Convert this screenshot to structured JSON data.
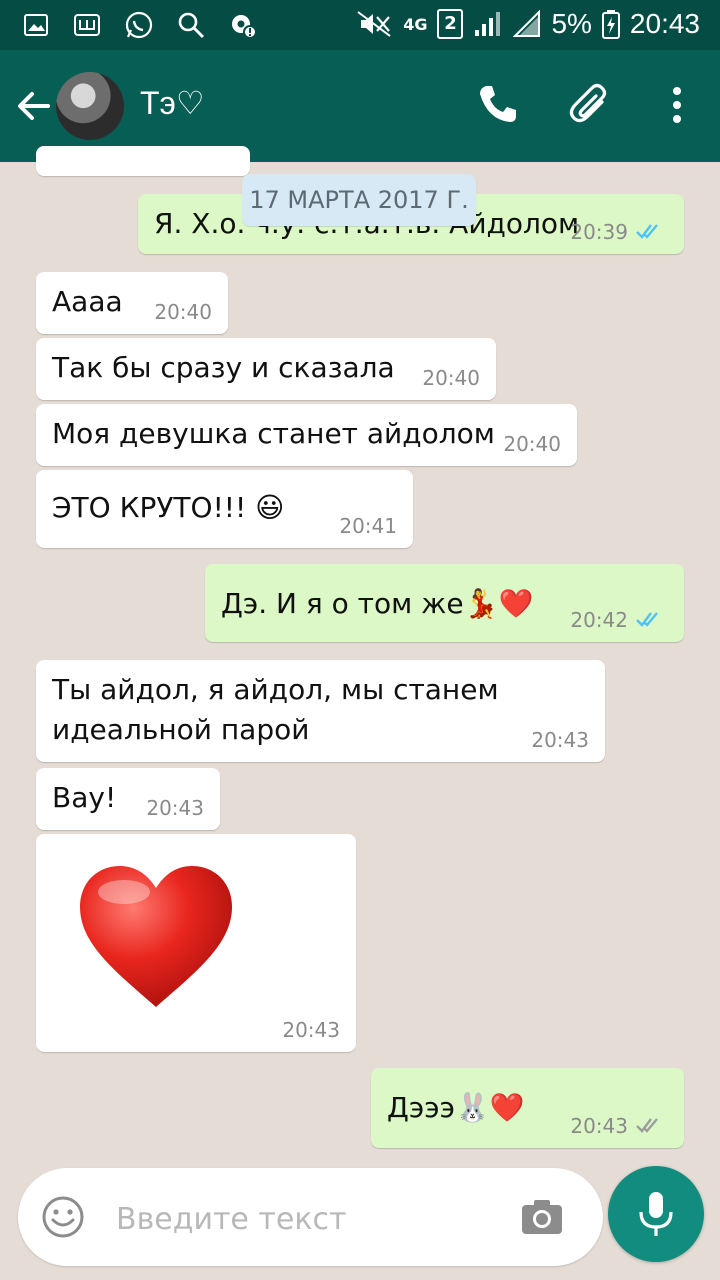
{
  "status_bar": {
    "network": "4G",
    "sim": "2",
    "battery": "5%",
    "time": "20:43",
    "left_icons": [
      "gallery-icon",
      "notification-icon",
      "whatsapp-icon",
      "search-icon",
      "settings-icon"
    ]
  },
  "header": {
    "contact_name": "Тэ♡",
    "icons": [
      "back-arrow-icon",
      "phone-icon",
      "attachment-icon",
      "more-vert-icon"
    ]
  },
  "chat": {
    "date_badge": "17 МАРТА 2017 Г.",
    "messages": [
      {
        "dir": "out",
        "text": "Я. Х.о. ч.у. с.т.а.т.ь. Айдолом",
        "time": "20:39",
        "status": "read"
      },
      {
        "dir": "in",
        "text": "Аааа",
        "time": "20:40"
      },
      {
        "dir": "in",
        "text": "Так бы сразу и сказала",
        "time": "20:40"
      },
      {
        "dir": "in",
        "text": "Моя девушка станет айдолом",
        "time": "20:40"
      },
      {
        "dir": "in",
        "text": "ЭТО КРУТО!!! 😃",
        "time": "20:41"
      },
      {
        "dir": "out",
        "text": "Дэ. И я о том же💃❤️",
        "time": "20:42",
        "status": "read"
      },
      {
        "dir": "in",
        "text": "Ты айдол, я айдол, мы станем идеальной парой",
        "time": "20:43"
      },
      {
        "dir": "in",
        "text": "Вау!",
        "time": "20:43"
      },
      {
        "dir": "in",
        "text": "❤️",
        "time": "20:43",
        "sticker": true
      },
      {
        "dir": "out",
        "text": "Дэээ🐰❤️",
        "time": "20:43",
        "status": "delivered"
      }
    ]
  },
  "composer": {
    "placeholder": "Введите текст",
    "value": ""
  },
  "colors": {
    "header": "#075e54",
    "statusbar": "#054d44",
    "outgoing_bubble": "#dcf8c6",
    "incoming_bubble": "#ffffff",
    "read_ticks": "#4fc3f7",
    "delivered_ticks": "#9e9e9e",
    "fab": "#128c7e"
  }
}
